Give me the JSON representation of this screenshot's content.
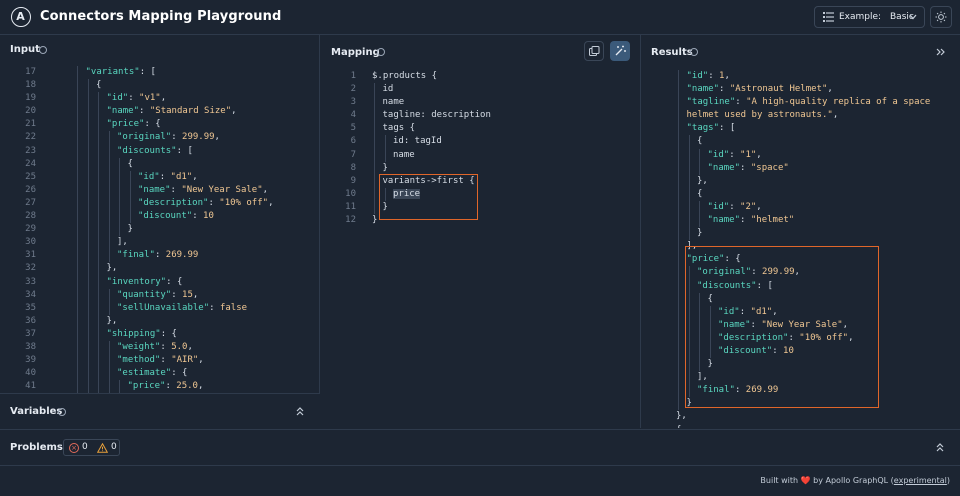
{
  "header": {
    "logo_letter": "A",
    "title": "Connectors Mapping Playground",
    "example_label": "Example:",
    "example_value": "Basic"
  },
  "input": {
    "title": "Input",
    "lines": [
      {
        "n": "17",
        "i": 3,
        "t": [
          [
            "k",
            "\"variants\""
          ],
          [
            "p",
            ": ["
          ]
        ]
      },
      {
        "n": "18",
        "i": 4,
        "t": [
          [
            "p",
            "{"
          ]
        ]
      },
      {
        "n": "19",
        "i": 5,
        "t": [
          [
            "k",
            "\"id\""
          ],
          [
            "p",
            ": "
          ],
          [
            "s",
            "\"v1\""
          ],
          [
            "p",
            ","
          ]
        ]
      },
      {
        "n": "20",
        "i": 5,
        "t": [
          [
            "k",
            "\"name\""
          ],
          [
            "p",
            ": "
          ],
          [
            "s",
            "\"Standard Size\""
          ],
          [
            "p",
            ","
          ]
        ]
      },
      {
        "n": "21",
        "i": 5,
        "t": [
          [
            "k",
            "\"price\""
          ],
          [
            "p",
            ": {"
          ]
        ]
      },
      {
        "n": "22",
        "i": 6,
        "t": [
          [
            "k",
            "\"original\""
          ],
          [
            "p",
            ": "
          ],
          [
            "n",
            "299.99"
          ],
          [
            "p",
            ","
          ]
        ]
      },
      {
        "n": "23",
        "i": 6,
        "t": [
          [
            "k",
            "\"discounts\""
          ],
          [
            "p",
            ": ["
          ]
        ]
      },
      {
        "n": "24",
        "i": 7,
        "t": [
          [
            "p",
            "{"
          ]
        ]
      },
      {
        "n": "25",
        "i": 8,
        "t": [
          [
            "k",
            "\"id\""
          ],
          [
            "p",
            ": "
          ],
          [
            "s",
            "\"d1\""
          ],
          [
            "p",
            ","
          ]
        ]
      },
      {
        "n": "26",
        "i": 8,
        "t": [
          [
            "k",
            "\"name\""
          ],
          [
            "p",
            ": "
          ],
          [
            "s",
            "\"New Year Sale\""
          ],
          [
            "p",
            ","
          ]
        ]
      },
      {
        "n": "27",
        "i": 8,
        "t": [
          [
            "k",
            "\"description\""
          ],
          [
            "p",
            ": "
          ],
          [
            "s",
            "\"10% off\""
          ],
          [
            "p",
            ","
          ]
        ]
      },
      {
        "n": "28",
        "i": 8,
        "t": [
          [
            "k",
            "\"discount\""
          ],
          [
            "p",
            ": "
          ],
          [
            "n",
            "10"
          ]
        ]
      },
      {
        "n": "29",
        "i": 7,
        "t": [
          [
            "p",
            "}"
          ]
        ]
      },
      {
        "n": "30",
        "i": 6,
        "t": [
          [
            "p",
            "],"
          ]
        ]
      },
      {
        "n": "31",
        "i": 6,
        "t": [
          [
            "k",
            "\"final\""
          ],
          [
            "p",
            ": "
          ],
          [
            "n",
            "269.99"
          ]
        ]
      },
      {
        "n": "32",
        "i": 5,
        "t": [
          [
            "p",
            "},"
          ]
        ]
      },
      {
        "n": "33",
        "i": 5,
        "t": [
          [
            "k",
            "\"inventory\""
          ],
          [
            "p",
            ": {"
          ]
        ]
      },
      {
        "n": "34",
        "i": 6,
        "t": [
          [
            "k",
            "\"quantity\""
          ],
          [
            "p",
            ": "
          ],
          [
            "n",
            "15"
          ],
          [
            "p",
            ","
          ]
        ]
      },
      {
        "n": "35",
        "i": 6,
        "t": [
          [
            "k",
            "\"sellUnavailable\""
          ],
          [
            "p",
            ": "
          ],
          [
            "n",
            "false"
          ]
        ]
      },
      {
        "n": "36",
        "i": 5,
        "t": [
          [
            "p",
            "},"
          ]
        ]
      },
      {
        "n": "37",
        "i": 5,
        "t": [
          [
            "k",
            "\"shipping\""
          ],
          [
            "p",
            ": {"
          ]
        ]
      },
      {
        "n": "38",
        "i": 6,
        "t": [
          [
            "k",
            "\"weight\""
          ],
          [
            "p",
            ": "
          ],
          [
            "n",
            "5.0"
          ],
          [
            "p",
            ","
          ]
        ]
      },
      {
        "n": "39",
        "i": 6,
        "t": [
          [
            "k",
            "\"method\""
          ],
          [
            "p",
            ": "
          ],
          [
            "s",
            "\"AIR\""
          ],
          [
            "p",
            ","
          ]
        ]
      },
      {
        "n": "40",
        "i": 6,
        "t": [
          [
            "k",
            "\"estimate\""
          ],
          [
            "p",
            ": {"
          ]
        ]
      },
      {
        "n": "41",
        "i": 7,
        "t": [
          [
            "k",
            "\"price\""
          ],
          [
            "p",
            ": "
          ],
          [
            "n",
            "25.0"
          ],
          [
            "p",
            ","
          ]
        ]
      }
    ]
  },
  "mapping": {
    "title": "Mapping",
    "lines": [
      {
        "n": "1",
        "i": 0,
        "t": [
          [
            "p",
            "$.products {"
          ]
        ]
      },
      {
        "n": "2",
        "i": 1,
        "t": [
          [
            "p",
            "id"
          ]
        ]
      },
      {
        "n": "3",
        "i": 1,
        "t": [
          [
            "p",
            "name"
          ]
        ]
      },
      {
        "n": "4",
        "i": 1,
        "t": [
          [
            "p",
            "tagline: description"
          ]
        ]
      },
      {
        "n": "5",
        "i": 1,
        "t": [
          [
            "p",
            "tags {"
          ]
        ]
      },
      {
        "n": "6",
        "i": 2,
        "t": [
          [
            "p",
            "id: tagId"
          ]
        ]
      },
      {
        "n": "7",
        "i": 2,
        "t": [
          [
            "p",
            "name"
          ]
        ]
      },
      {
        "n": "8",
        "i": 1,
        "t": [
          [
            "p",
            "}"
          ]
        ]
      },
      {
        "n": "9",
        "i": 1,
        "t": [
          [
            "p",
            "variants->first {"
          ]
        ]
      },
      {
        "n": "10",
        "i": 2,
        "t": [
          [
            "p",
            "price"
          ]
        ]
      },
      {
        "n": "11",
        "i": 1,
        "t": [
          [
            "p",
            "}"
          ]
        ]
      },
      {
        "n": "12",
        "i": 0,
        "t": [
          [
            "p",
            "}"
          ]
        ]
      }
    ]
  },
  "results": {
    "title": "Results",
    "lines": [
      {
        "i": 1,
        "t": [
          [
            "k",
            "\"id\""
          ],
          [
            "p",
            ": "
          ],
          [
            "n",
            "1"
          ],
          [
            "p",
            ","
          ]
        ]
      },
      {
        "i": 1,
        "t": [
          [
            "k",
            "\"name\""
          ],
          [
            "p",
            ": "
          ],
          [
            "s",
            "\"Astronaut Helmet\""
          ],
          [
            "p",
            ","
          ]
        ]
      },
      {
        "i": 1,
        "t": [
          [
            "k",
            "\"tagline\""
          ],
          [
            "p",
            ": "
          ],
          [
            "s",
            "\"A high-quality replica of a space"
          ]
        ]
      },
      {
        "i": 1,
        "t": [
          [
            "s",
            "helmet used by astronauts.\""
          ],
          [
            "p",
            ","
          ]
        ]
      },
      {
        "i": 1,
        "t": [
          [
            "k",
            "\"tags\""
          ],
          [
            "p",
            ": ["
          ]
        ]
      },
      {
        "i": 2,
        "t": [
          [
            "p",
            "{"
          ]
        ]
      },
      {
        "i": 3,
        "t": [
          [
            "k",
            "\"id\""
          ],
          [
            "p",
            ": "
          ],
          [
            "s",
            "\"1\""
          ],
          [
            "p",
            ","
          ]
        ]
      },
      {
        "i": 3,
        "t": [
          [
            "k",
            "\"name\""
          ],
          [
            "p",
            ": "
          ],
          [
            "s",
            "\"space\""
          ]
        ]
      },
      {
        "i": 2,
        "t": [
          [
            "p",
            "},"
          ]
        ]
      },
      {
        "i": 2,
        "t": [
          [
            "p",
            "{"
          ]
        ]
      },
      {
        "i": 3,
        "t": [
          [
            "k",
            "\"id\""
          ],
          [
            "p",
            ": "
          ],
          [
            "s",
            "\"2\""
          ],
          [
            "p",
            ","
          ]
        ]
      },
      {
        "i": 3,
        "t": [
          [
            "k",
            "\"name\""
          ],
          [
            "p",
            ": "
          ],
          [
            "s",
            "\"helmet\""
          ]
        ]
      },
      {
        "i": 2,
        "t": [
          [
            "p",
            "}"
          ]
        ]
      },
      {
        "i": 1,
        "t": [
          [
            "p",
            "],"
          ]
        ]
      },
      {
        "i": 1,
        "t": [
          [
            "k",
            "\"price\""
          ],
          [
            "p",
            ": {"
          ]
        ]
      },
      {
        "i": 2,
        "t": [
          [
            "k",
            "\"original\""
          ],
          [
            "p",
            ": "
          ],
          [
            "n",
            "299.99"
          ],
          [
            "p",
            ","
          ]
        ]
      },
      {
        "i": 2,
        "t": [
          [
            "k",
            "\"discounts\""
          ],
          [
            "p",
            ": ["
          ]
        ]
      },
      {
        "i": 3,
        "t": [
          [
            "p",
            "{"
          ]
        ]
      },
      {
        "i": 4,
        "t": [
          [
            "k",
            "\"id\""
          ],
          [
            "p",
            ": "
          ],
          [
            "s",
            "\"d1\""
          ],
          [
            "p",
            ","
          ]
        ]
      },
      {
        "i": 4,
        "t": [
          [
            "k",
            "\"name\""
          ],
          [
            "p",
            ": "
          ],
          [
            "s",
            "\"New Year Sale\""
          ],
          [
            "p",
            ","
          ]
        ]
      },
      {
        "i": 4,
        "t": [
          [
            "k",
            "\"description\""
          ],
          [
            "p",
            ": "
          ],
          [
            "s",
            "\"10% off\""
          ],
          [
            "p",
            ","
          ]
        ]
      },
      {
        "i": 4,
        "t": [
          [
            "k",
            "\"discount\""
          ],
          [
            "p",
            ": "
          ],
          [
            "n",
            "10"
          ]
        ]
      },
      {
        "i": 3,
        "t": [
          [
            "p",
            "}"
          ]
        ]
      },
      {
        "i": 2,
        "t": [
          [
            "p",
            "],"
          ]
        ]
      },
      {
        "i": 2,
        "t": [
          [
            "k",
            "\"final\""
          ],
          [
            "p",
            ": "
          ],
          [
            "n",
            "269.99"
          ]
        ]
      },
      {
        "i": 1,
        "t": [
          [
            "p",
            "}"
          ]
        ]
      },
      {
        "i": 0,
        "t": [
          [
            "p",
            "},"
          ]
        ]
      },
      {
        "i": 0,
        "t": [
          [
            "p",
            "{"
          ]
        ]
      }
    ]
  },
  "variables": {
    "title": "Variables"
  },
  "problems": {
    "title": "Problems",
    "errors": "0",
    "warnings": "0"
  },
  "footer": {
    "built_with": "Built with",
    "heart": "❤️",
    "by": "by Apollo GraphQL",
    "experimental": "experimental"
  },
  "colors": {
    "accent": "#e0662a",
    "key": "#5ad7c0",
    "string": "#f0c793"
  }
}
